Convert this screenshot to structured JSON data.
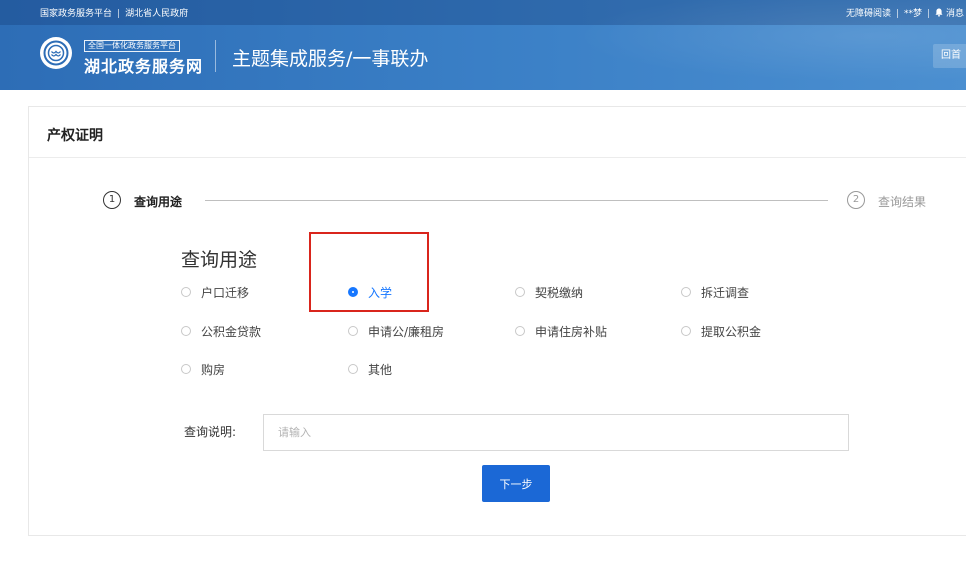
{
  "topbar": {
    "left_items": [
      "国家政务服务平台",
      "湖北省人民政府"
    ],
    "accessibility_label": "无障碍阅读",
    "user_name": "**梦",
    "messages_label": "消息"
  },
  "header": {
    "logo_small_text": "全国一体化政务服务平台",
    "logo_text": "湖北政务服务网",
    "title": "主题集成服务/一事联办",
    "home_button_label": "回首"
  },
  "card": {
    "title": "产权证明"
  },
  "steps": [
    {
      "number": "1",
      "label": "查询用途"
    },
    {
      "number": "2",
      "label": "查询结果"
    }
  ],
  "purpose": {
    "heading": "查询用途",
    "selected": "入学",
    "options": [
      "户口迁移",
      "入学",
      "契税缴纳",
      "拆迁调查",
      "公积金贷款",
      "申请公/廉租房",
      "申请住房补贴",
      "提取公积金",
      "购房",
      "其他"
    ]
  },
  "description": {
    "label": "查询说明:",
    "placeholder": "请输入",
    "value": ""
  },
  "next_button_label": "下一步",
  "colors": {
    "header_blue": "#2d6db6",
    "accent_blue": "#1677ff",
    "button_blue": "#1b68d6",
    "highlight_red": "#d9251c"
  }
}
